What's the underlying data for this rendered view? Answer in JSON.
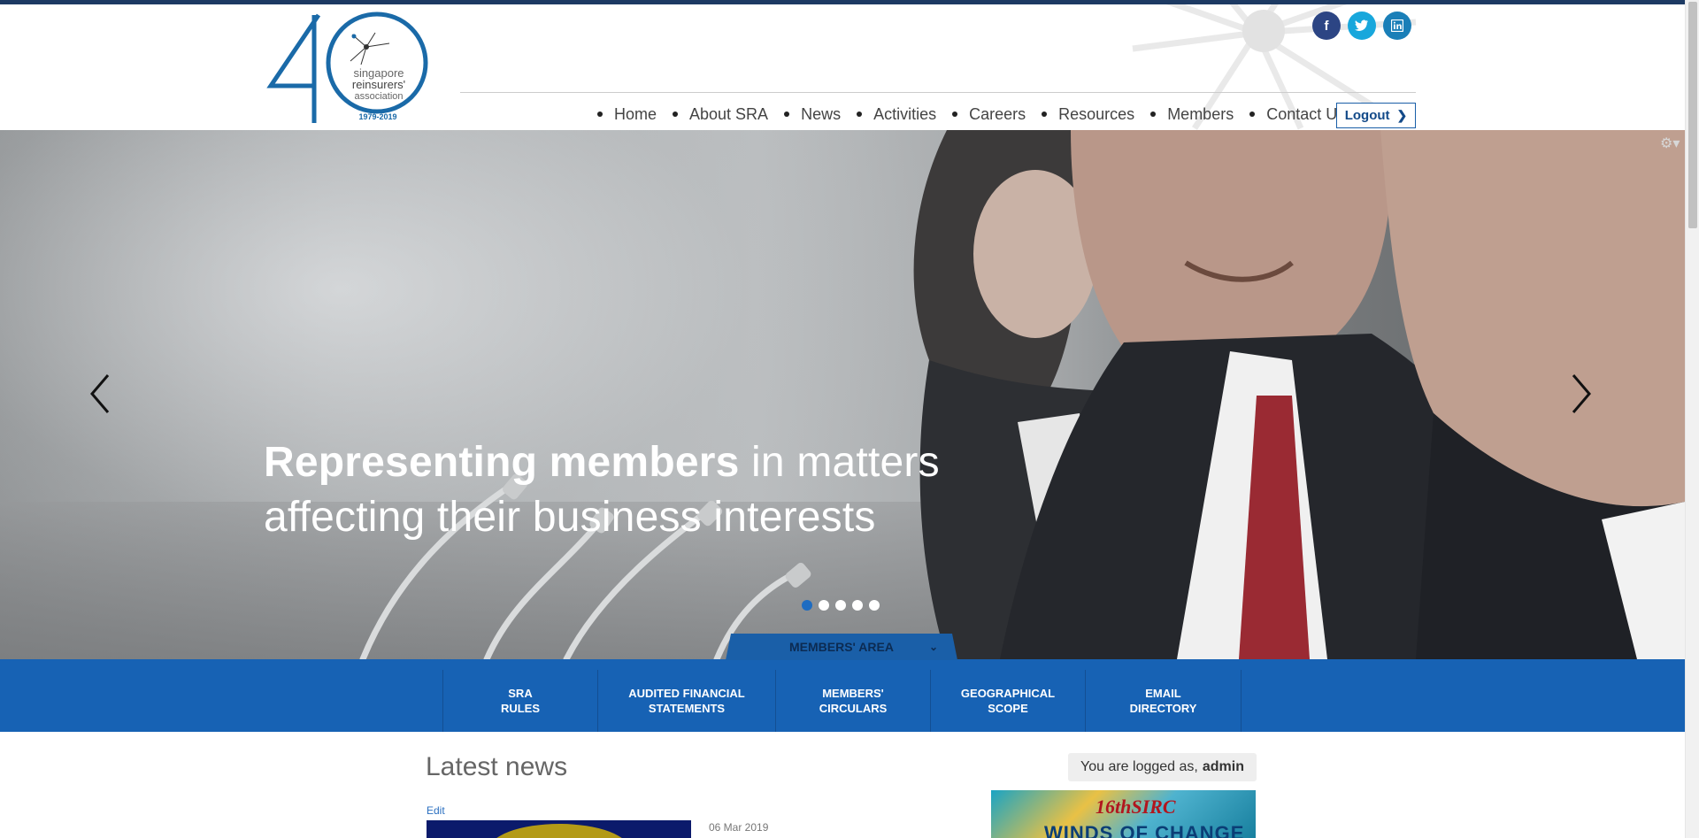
{
  "brand": {
    "logo_number": "40",
    "logo_line1": "singapore",
    "logo_line2": "reinsurers'",
    "logo_line3": "association",
    "logo_years": "1979-2019"
  },
  "social": {
    "facebook": "f",
    "twitter": "t",
    "linkedin": "in"
  },
  "nav": {
    "items": [
      {
        "label": "Home"
      },
      {
        "label": "About SRA"
      },
      {
        "label": "News"
      },
      {
        "label": "Activities"
      },
      {
        "label": "Careers"
      },
      {
        "label": "Resources"
      },
      {
        "label": "Members"
      },
      {
        "label": "Contact Us"
      }
    ],
    "logout_label": "Logout"
  },
  "hero": {
    "headline_bold": "Representing members",
    "headline_rest": " in matters",
    "headline_line2": "affecting their business interests",
    "slides_total": 5,
    "active_slide": 1
  },
  "members_area": {
    "tab_label": "MEMBERS' AREA",
    "links": [
      {
        "line1": "SRA",
        "line2": "RULES"
      },
      {
        "line1": "AUDITED FINANCIAL",
        "line2": "STATEMENTS"
      },
      {
        "line1": "MEMBERS'",
        "line2": "CIRCULARS"
      },
      {
        "line1": "GEOGRAPHICAL",
        "line2": "SCOPE"
      },
      {
        "line1": "EMAIL",
        "line2": "DIRECTORY"
      }
    ]
  },
  "content": {
    "latest_title": "Latest news",
    "edit_label": "Edit",
    "news_date": "06 Mar 2019",
    "logged_prefix": "You are logged as,",
    "logged_user": "admin",
    "banner_title": "16thSIRC",
    "banner_sub": "WINDS OF CHANGE"
  },
  "colors": {
    "brand_blue": "#1762b4",
    "dark_blue": "#1d3a63",
    "active_dot": "#1e6cc1"
  },
  "icons": [
    "facebook-icon",
    "twitter-icon",
    "linkedin-icon",
    "chevron-right-icon",
    "arrow-left-icon",
    "arrow-right-icon",
    "gear-icon",
    "chevron-down-icon"
  ]
}
